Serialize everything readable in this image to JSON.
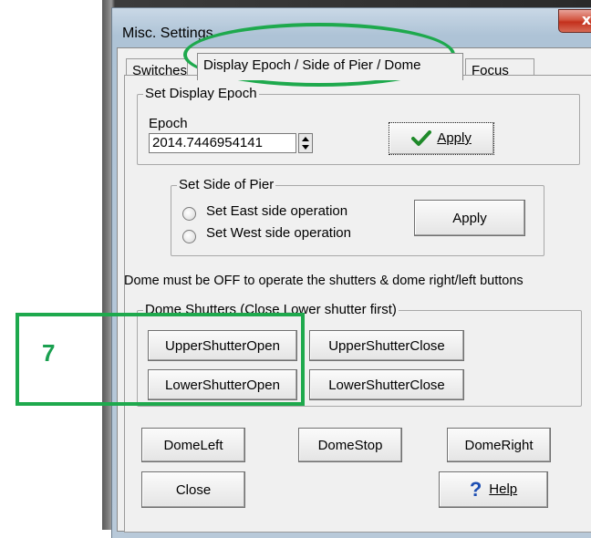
{
  "window": {
    "title": "Misc. Settings",
    "close_glyph": "x"
  },
  "tabs": [
    {
      "label": "Switches"
    },
    {
      "label": "Display Epoch / Side of Pier / Dome"
    },
    {
      "label": "Focus"
    }
  ],
  "epoch_group": {
    "legend": "Set Display Epoch",
    "field_label": "Epoch",
    "value": "2014.7446954141",
    "apply_label": "Apply"
  },
  "pier_group": {
    "legend": "Set Side of Pier",
    "east_label": "Set East side operation",
    "west_label": "Set West side operation",
    "apply_label": "Apply"
  },
  "dome_note": "Dome must be OFF to operate the shutters & dome right/left buttons",
  "shutters_group": {
    "legend": "Dome Shutters   (Close Lower shutter first)",
    "upper_open": "UpperShutterOpen",
    "upper_close": "UpperShutterClose",
    "lower_open": "LowerShutterOpen",
    "lower_close": "LowerShutterClose"
  },
  "dome_buttons": {
    "left": "DomeLeft",
    "stop": "DomeStop",
    "right": "DomeRight"
  },
  "footer": {
    "close": "Close",
    "help": "Help"
  },
  "annotation": {
    "step_number": "7",
    "color": "#1ea94d"
  },
  "icons": {
    "apply_check": "checkmark-icon",
    "help": "question-mark-icon",
    "spin": "spin-updown-icon"
  }
}
